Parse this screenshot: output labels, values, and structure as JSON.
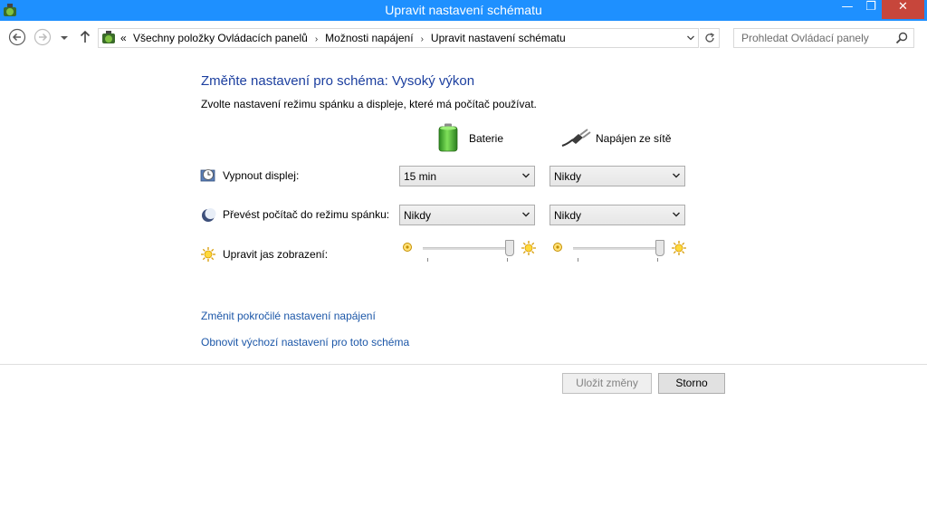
{
  "window": {
    "title": "Upravit nastavení schématu",
    "minimize_glyph": "—",
    "maximize_glyph": "❐",
    "close_glyph": "✕"
  },
  "nav": {
    "breadcrumb_overflow": "«",
    "breadcrumbs": [
      "Všechny položky Ovládacích panelů",
      "Možnosti napájení",
      "Upravit nastavení schématu"
    ],
    "separator": "›",
    "search_placeholder": "Prohledat Ovládací panely"
  },
  "content": {
    "title": "Změňte nastavení pro schéma: Vysoký výkon",
    "subtitle": "Zvolte nastavení režimu spánku a displeje, které má počítač používat.",
    "columns": {
      "battery": "Baterie",
      "plugged": "Napájen ze sítě"
    },
    "rows": {
      "display": {
        "label": "Vypnout displej:",
        "battery_value": "15 min",
        "plugged_value": "Nikdy"
      },
      "sleep": {
        "label": "Převést počítač do režimu spánku:",
        "battery_value": "Nikdy",
        "plugged_value": "Nikdy"
      },
      "brightness": {
        "label": "Upravit jas zobrazení:",
        "battery_level": 1.0,
        "plugged_level": 1.0
      }
    },
    "links": {
      "advanced": "Změnit pokročilé nastavení napájení",
      "restore": "Obnovit výchozí nastavení pro toto schéma"
    }
  },
  "buttons": {
    "save": "Uložit změny",
    "cancel": "Storno"
  },
  "colors": {
    "titlebar": "#1e90ff",
    "title_text": "#1c3f9f",
    "link": "#1c57a8",
    "close_button": "#c7463b"
  }
}
